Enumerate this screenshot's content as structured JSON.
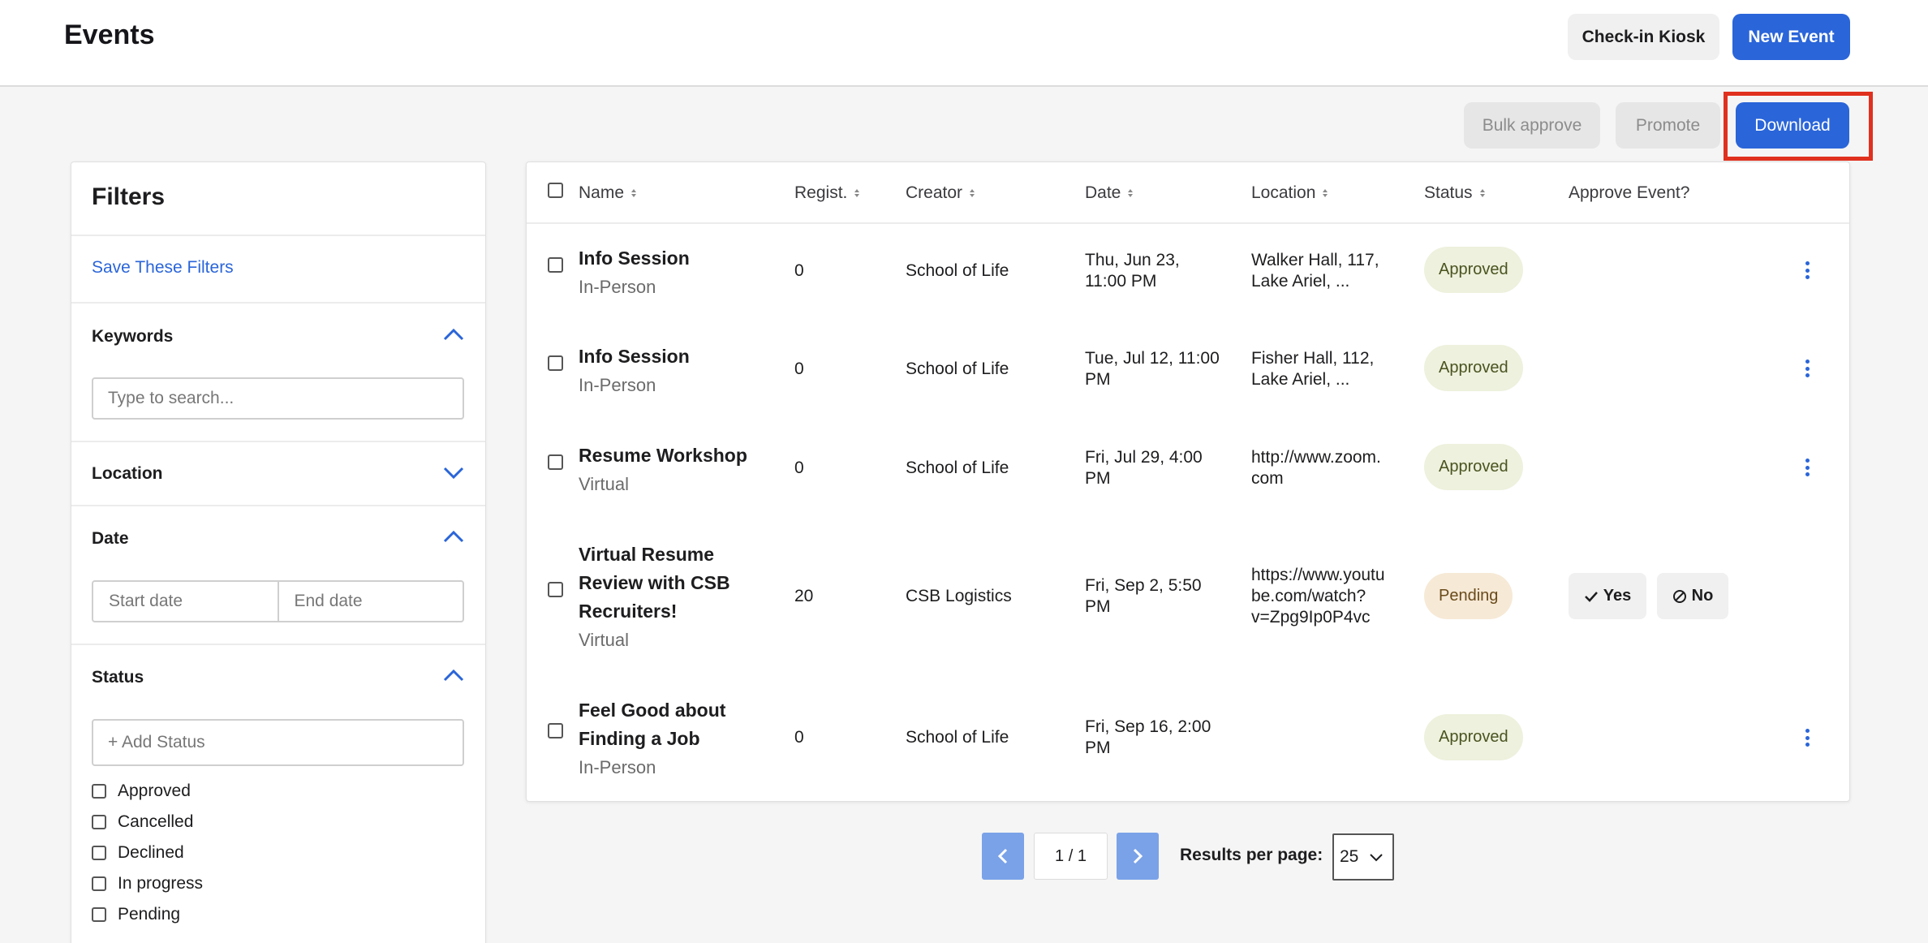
{
  "header": {
    "title": "Events",
    "kiosk_label": "Check-in Kiosk",
    "new_event_label": "New Event"
  },
  "toolbar": {
    "bulk_approve_label": "Bulk approve",
    "promote_label": "Promote",
    "download_label": "Download"
  },
  "filters": {
    "title": "Filters",
    "save_label": "Save These Filters",
    "keywords": {
      "label": "Keywords",
      "placeholder": "Type to search...",
      "expanded": true
    },
    "location": {
      "label": "Location",
      "expanded": false
    },
    "date": {
      "label": "Date",
      "start_placeholder": "Start date",
      "end_placeholder": "End date",
      "expanded": true
    },
    "status": {
      "label": "Status",
      "placeholder": "+ Add Status",
      "expanded": true,
      "options": [
        "Approved",
        "Cancelled",
        "Declined",
        "In progress",
        "Pending"
      ]
    }
  },
  "table": {
    "columns": {
      "name": "Name",
      "registered": "Regist.",
      "creator": "Creator",
      "date": "Date",
      "location": "Location",
      "status": "Status",
      "approve": "Approve Event?"
    },
    "rows": [
      {
        "name_lines": [
          "Info Session"
        ],
        "type": "In-Person",
        "registered": "0",
        "creator": "School of Life",
        "date_lines": [
          "Thu, Jun 23,",
          "11:00 PM"
        ],
        "location_lines": [
          "Walker Hall, 117,",
          "Lake Ariel, ..."
        ],
        "status": "Approved"
      },
      {
        "name_lines": [
          "Info Session"
        ],
        "type": "In-Person",
        "registered": "0",
        "creator": "School of Life",
        "date_lines": [
          "Tue, Jul 12, 11:00",
          "PM"
        ],
        "location_lines": [
          "Fisher Hall, 112,",
          "Lake Ariel, ..."
        ],
        "status": "Approved"
      },
      {
        "name_lines": [
          "Resume Workshop"
        ],
        "type": "Virtual",
        "registered": "0",
        "creator": "School of Life",
        "date_lines": [
          "Fri, Jul 29, 4:00",
          "PM"
        ],
        "location_lines": [
          "http://www.zoom.",
          "com"
        ],
        "status": "Approved"
      },
      {
        "name_lines": [
          "Virtual Resume",
          "Review with CSB",
          "Recruiters!"
        ],
        "type": "Virtual",
        "registered": "20",
        "creator": "CSB Logistics",
        "date_lines": [
          "Fri, Sep 2, 5:50",
          "PM"
        ],
        "location_lines": [
          "https://www.youtu",
          "be.com/watch?",
          "v=Zpg9Ip0P4vc"
        ],
        "status": "Pending",
        "approve_yes": "Yes",
        "approve_no": "No"
      },
      {
        "name_lines": [
          "Feel Good about",
          "Finding a Job"
        ],
        "type": "In-Person",
        "registered": "0",
        "creator": "School of Life",
        "date_lines": [
          "Fri, Sep 16, 2:00",
          "PM"
        ],
        "location_lines": [],
        "status": "Approved"
      }
    ]
  },
  "pagination": {
    "page_info": "1 / 1",
    "results_label": "Results per page:",
    "per_page": "25"
  },
  "colors": {
    "primary": "#2a65d9",
    "highlight": "#e0301e",
    "approved_bg": "#edf1dd",
    "pending_bg": "#f6e9d6"
  },
  "icons": {
    "chevron_up": "chevron-up-icon",
    "chevron_down": "chevron-down-icon",
    "sort": "sort-icon",
    "more": "more-vertical-icon",
    "check": "check-icon",
    "block": "block-icon",
    "prev": "chevron-left-icon",
    "next": "chevron-right-icon"
  }
}
